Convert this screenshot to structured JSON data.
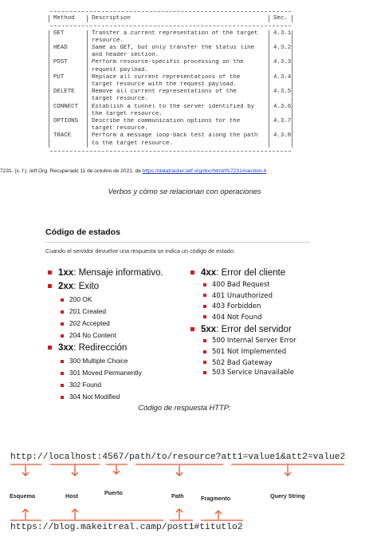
{
  "rfc_table": {
    "headers": {
      "method": "Method",
      "description": "Description",
      "sec": "Sec."
    },
    "rows": [
      {
        "method": "GET",
        "description": [
          "Transfer a current representation of the target",
          "resource."
        ],
        "sec": "4.3.1"
      },
      {
        "method": "HEAD",
        "description": [
          "Same as GET, but only transfer the status line",
          "and header section."
        ],
        "sec": "4.3.2"
      },
      {
        "method": "POST",
        "description": [
          "Perform resource-specific processing on the",
          "request payload."
        ],
        "sec": "4.3.3"
      },
      {
        "method": "PUT",
        "description": [
          "Replace all current representations of the",
          "target resource with the request payload."
        ],
        "sec": "4.3.4"
      },
      {
        "method": "DELETE",
        "description": [
          "Remove all current representations of the",
          "target resource."
        ],
        "sec": "4.3.5"
      },
      {
        "method": "CONNECT",
        "description": [
          "Establish a tunnel to the server identified by",
          "the target resource."
        ],
        "sec": "4.3.6"
      },
      {
        "method": "OPTIONS",
        "description": [
          "Describe the communication options for the",
          "target resource."
        ],
        "sec": "4.3.7"
      },
      {
        "method": "TRACE",
        "description": [
          "Perform a message loop-back test along the path",
          "to the target resource."
        ],
        "sec": "4.3.8"
      }
    ]
  },
  "citation": {
    "text": "7231. (s. f.). Ietf.Org. Recuperado 11 de octubre de 2021, de ",
    "link": "https://datatracker.ietf.org/doc/html/rfc7231#section-4"
  },
  "caption1": "Verbos y cómo se relacionan con operaciones",
  "status_slide": {
    "title": "Código de estados",
    "subtitle": "Cuando el servidor devuelve una respuesta se indica un código de estado:",
    "left": [
      {
        "code": "1xx",
        "label": ": Mensaje informativo.",
        "items": []
      },
      {
        "code": "2xx",
        "label": ": Exito",
        "items": [
          "200 OK",
          "201 Created",
          "202 Accepted",
          "204 No Content"
        ]
      },
      {
        "code": "3xx",
        "label": ": Redirección",
        "items": [
          "300 Multiple Choice",
          "301 Moved Permanently",
          "302 Found",
          "304 Not Modified"
        ]
      }
    ],
    "right": [
      {
        "code": "4xx",
        "label": ": Error del cliente",
        "items": [
          "400 Bad Request",
          "401 Unauthorized",
          "403 Forbidden",
          "404 Not Found"
        ]
      },
      {
        "code": "5xx",
        "label": ": Error del servidor",
        "items": [
          "500 Internal Server Error",
          "501 Not Implemented",
          "502 Bad Gateway",
          "503 Service Unavailable"
        ]
      }
    ],
    "accent_color": "#d7191c"
  },
  "caption2": "Código de respuesta HTTP:",
  "url_diagram": {
    "url_top": "http://localhost:4567/path/to/resource?att1=value1&att2=value2",
    "url_bottom": "https://blog.makeitreal.camp/post1#titutlo2",
    "parts": {
      "scheme": "Esquema",
      "host": "Host",
      "port": "Puerto",
      "path": "Path",
      "fragment": "Fragmento",
      "query": "Query String"
    },
    "bracket_color": "#e8532b"
  }
}
